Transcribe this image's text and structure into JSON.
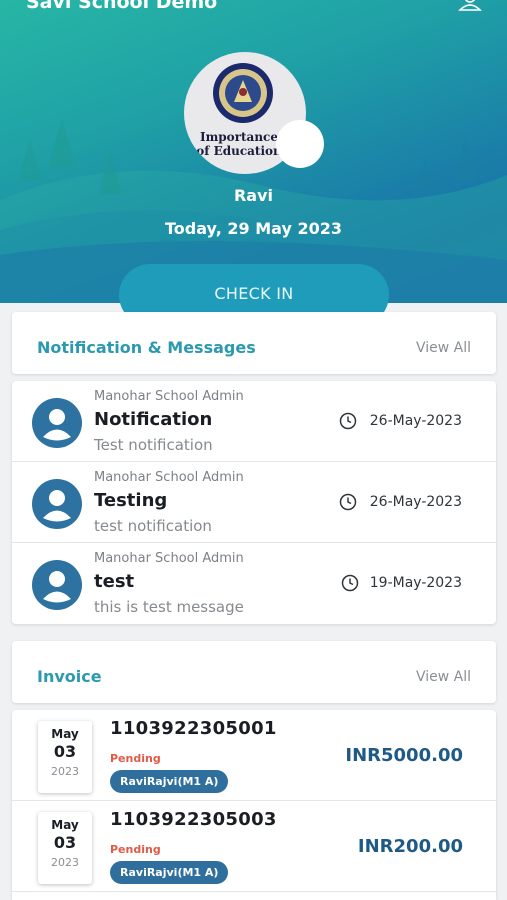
{
  "app": {
    "title": "Savi School Demo",
    "profile_icon": "user-icon"
  },
  "profile": {
    "logo_seal_text": "SHIVANSH ICCHA",
    "logo_text_line1": "Importance",
    "logo_text_line2": "of Education",
    "name": "Ravi",
    "date": "Today, 29 May 2023"
  },
  "checkin": {
    "label": "CHECK IN"
  },
  "notifications": {
    "title": "Notification & Messages",
    "view_all": "View All",
    "items": [
      {
        "sender": "Manohar School Admin",
        "title": "Notification",
        "body": "Test notification",
        "date": "26-May-2023"
      },
      {
        "sender": "Manohar School Admin",
        "title": "Testing",
        "body": "test notification",
        "date": "26-May-2023"
      },
      {
        "sender": "Manohar School Admin",
        "title": "test",
        "body": "this is test message",
        "date": "19-May-2023"
      }
    ]
  },
  "invoice": {
    "title": "Invoice",
    "view_all": "View All",
    "items": [
      {
        "month": "May",
        "day": "03",
        "year": "2023",
        "number": "1103922305001",
        "status": "Pending",
        "student": "RaviRajvi(M1 A)",
        "amount": "INR5000.00"
      },
      {
        "month": "May",
        "day": "03",
        "year": "2023",
        "number": "1103922305003",
        "status": "Pending",
        "student": "RaviRajvi(M1 A)",
        "amount": "INR200.00"
      }
    ]
  },
  "colors": {
    "accent": "#2b9ab0",
    "pending": "#e05a46",
    "amount": "#1f5a86",
    "badge": "#2f6f9e"
  }
}
